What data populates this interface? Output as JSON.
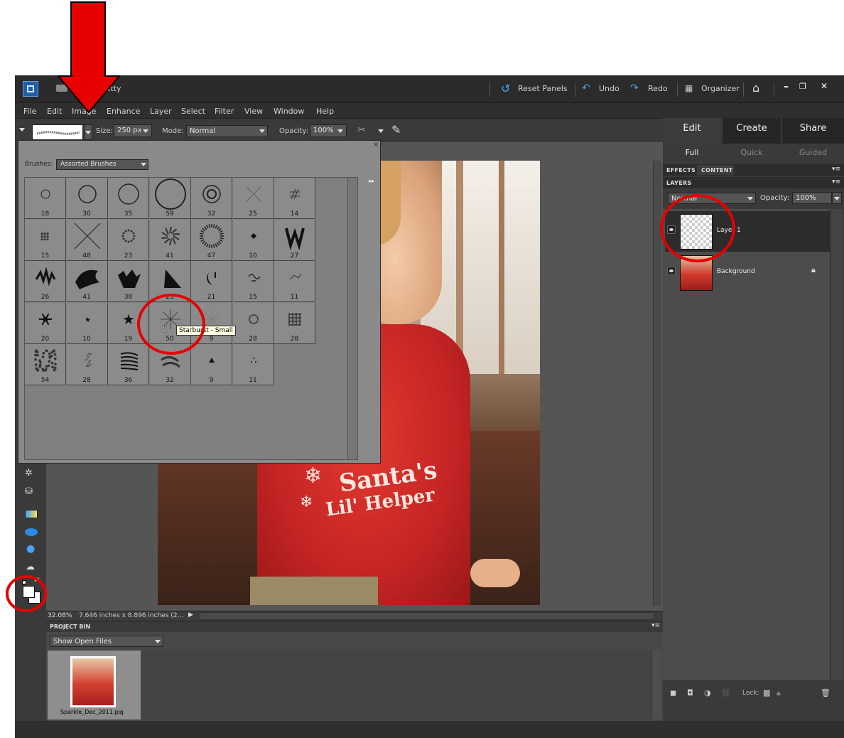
{
  "title_bar": {
    "user_label": "Home, Patty",
    "reset_panels_label": "Reset Panels",
    "undo_label": "Undo",
    "redo_label": "Redo",
    "organizer_label": "Organizer",
    "min_glyph": "–",
    "restore_glyph": "❐",
    "close_glyph": "✕"
  },
  "menu": [
    "File",
    "Edit",
    "Image",
    "Enhance",
    "Layer",
    "Select",
    "Filter",
    "View",
    "Window",
    "Help"
  ],
  "options_bar": {
    "size_label": "Size:",
    "size_value": "250 px",
    "mode_label": "Mode:",
    "mode_value": "Normal",
    "opacity_label": "Opacity:",
    "opacity_value": "100%"
  },
  "brush_picker": {
    "close_glyph": "×",
    "brushes_label": "Brushes:",
    "brushes_value": "Assorted Brushes",
    "menu_glyph": "▸▸",
    "sizes": [
      "18",
      "30",
      "35",
      "59",
      "32",
      "25",
      "14",
      "15",
      "48",
      "23",
      "41",
      "47",
      "10",
      "27",
      "26",
      "41",
      "38",
      "23",
      "21",
      "15",
      "11",
      "20",
      "10",
      "19",
      "50",
      "9",
      "28",
      "28",
      "54",
      "28",
      "36",
      "32",
      "9",
      "11"
    ],
    "tooltip": "Starburst - Small"
  },
  "right_panel": {
    "tabs": [
      "Edit",
      "Create",
      "Share"
    ],
    "subtabs": [
      "Full",
      "Quick",
      "Guided"
    ],
    "effects_label": "EFFECTS",
    "content_label": "CONTENT",
    "layers_label": "LAYERS",
    "blend_mode": "Normal",
    "opacity_label": "Opacity:",
    "opacity_value": "100%",
    "layers": [
      {
        "name": "Layer 1"
      },
      {
        "name": "Background"
      }
    ],
    "lock_label": "Lock:"
  },
  "status_bar": {
    "zoom": "32.08%",
    "doc_info": "7.646 inches x 8.896 inches (2..."
  },
  "project_bin": {
    "header": "PROJECT BIN",
    "show_value": "Show Open Files",
    "file_name": "Sparkle_Dec_2011.jpg"
  },
  "photo": {
    "shirt_line1": "Santa's",
    "shirt_line2": "Lil' Helper"
  },
  "colors": {
    "annotation_red": "#e60000",
    "shirt_red": "#d42a2a"
  }
}
